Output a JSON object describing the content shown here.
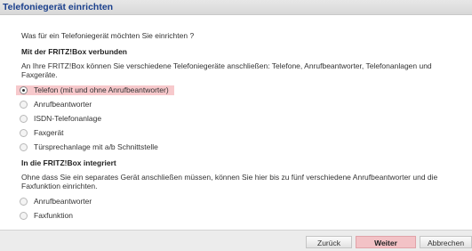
{
  "window": {
    "title": "Telefoniegerät einrichten"
  },
  "main": {
    "question": "Was für ein Telefoniegerät möchten Sie einrichten ?",
    "section_connected": {
      "heading": "Mit der FRITZ!Box verbunden",
      "description": "An Ihre FRITZ!Box können Sie verschiedene Telefoniegeräte anschließen: Telefone, Anrufbeantworter, Telefonanlagen und Faxgeräte.",
      "options": [
        {
          "label": "Telefon (mit und ohne Anrufbeantworter)",
          "selected": true
        },
        {
          "label": "Anrufbeantworter",
          "selected": false
        },
        {
          "label": "ISDN-Telefonanlage",
          "selected": false
        },
        {
          "label": "Faxgerät",
          "selected": false
        },
        {
          "label": "Türsprechanlage mit a/b Schnittstelle",
          "selected": false
        }
      ]
    },
    "section_integrated": {
      "heading": "In die FRITZ!Box integriert",
      "description": "Ohne dass Sie ein separates Gerät anschließen müssen, können Sie hier bis zu fünf verschiedene Anrufbeantworter und die Faxfunktion einrichten.",
      "options": [
        {
          "label": "Anrufbeantworter",
          "selected": false
        },
        {
          "label": "Faxfunktion",
          "selected": false
        }
      ]
    }
  },
  "footer": {
    "back_label": "Zurück",
    "next_label": "Weiter",
    "cancel_label": "Abbrechen"
  },
  "colors": {
    "title_text": "#1a3f8c",
    "selected_highlight": "#f7c9cc",
    "primary_button": "#f3c2c6"
  }
}
